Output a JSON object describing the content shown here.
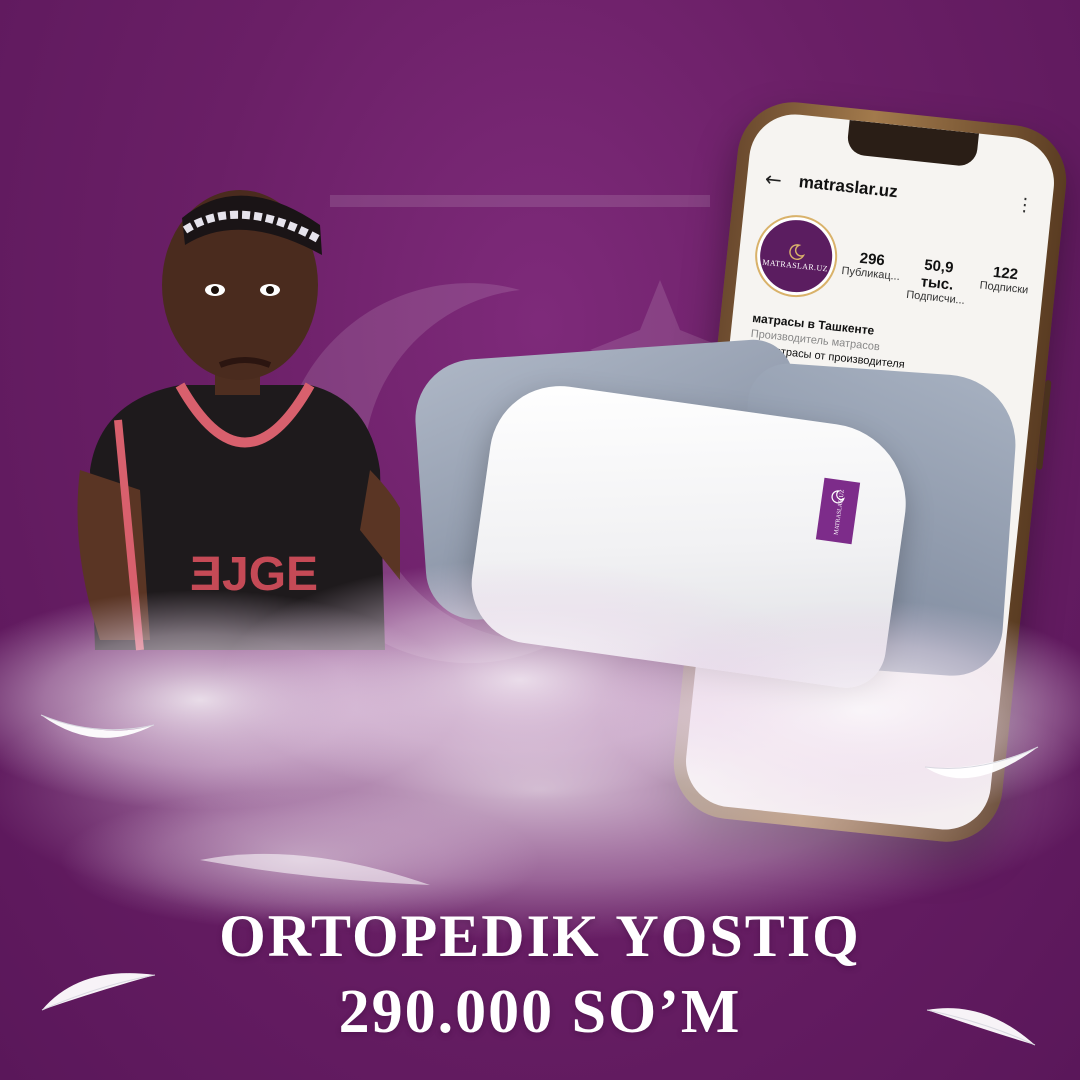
{
  "instagram": {
    "username": "matraslar.uz",
    "avatar_text": "MATRASLAR.UZ",
    "stats": [
      {
        "value": "296",
        "label": "Публикац..."
      },
      {
        "value": "50,9 тыс.",
        "label": "Подписчи..."
      },
      {
        "value": "122",
        "label": "Подписки"
      }
    ],
    "bio_name": "матрасы в Ташкенте",
    "bio_category": "Производитель матрасов",
    "bio_line": "🌙 Матрасы от производителя"
  },
  "pillow_tag_text": "MATRASLAR.UZ",
  "headline": {
    "title": "ORTOPEDIK YOSTIQ",
    "price": "290.000 SO’M"
  },
  "colors": {
    "background": "#6a1f66",
    "brand_purple": "#7d2c8a",
    "text": "#ffffff"
  },
  "icons": [
    "back-arrow-icon",
    "more-vertical-icon",
    "crescent-moon-icon",
    "feather-icon"
  ]
}
